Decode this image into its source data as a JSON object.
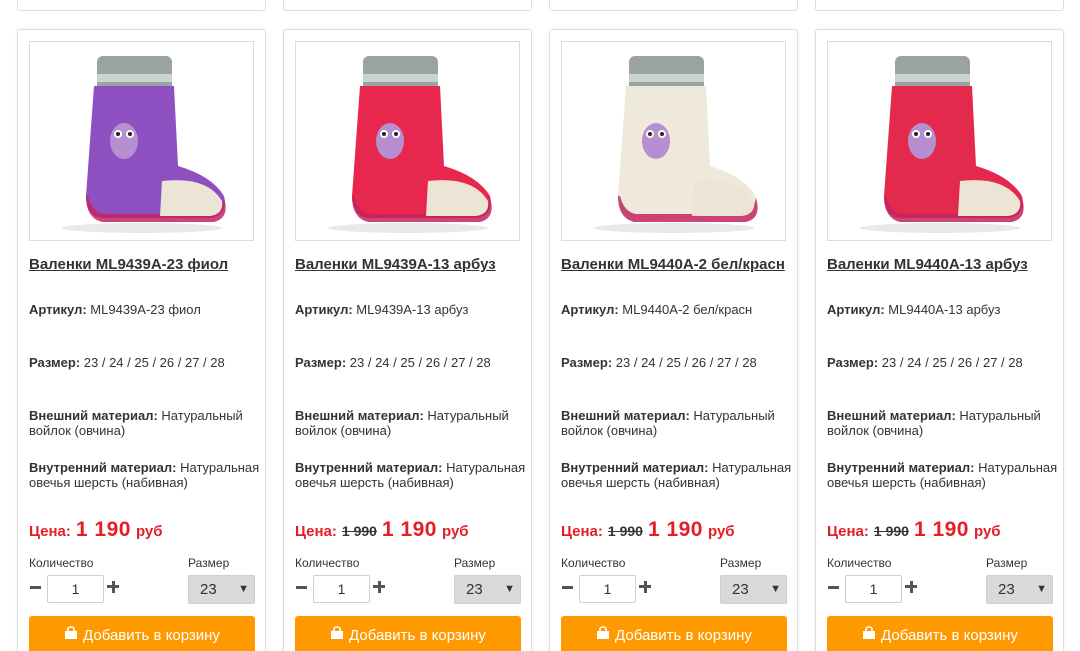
{
  "products": [
    {
      "name": "Валенки ML9439A-23 фиол",
      "article_label": "Артикул:",
      "article": "ML9439A-23 фиол",
      "size_label": "Размер:",
      "sizes": "23 / 24 / 25 / 26 / 27 / 28",
      "outer_label": "Внешний материал:",
      "outer": "Натуральный войлок (овчина)",
      "inner_label": "Внутренний материал:",
      "inner": "Натуральная овечья шерсть (набивная)",
      "price_label": "Цена:",
      "old_price": "",
      "price": "1 190",
      "currency": "руб",
      "qty_label": "Количество",
      "qty": "1",
      "size_select_label": "Размер",
      "size_selected": "23",
      "button": "Добавить в корзину",
      "boot_color": "#8e4fc1"
    },
    {
      "name": "Валенки ML9439A-13 арбуз",
      "article_label": "Артикул:",
      "article": "ML9439A-13 арбуз",
      "size_label": "Размер:",
      "sizes": "23 / 24 / 25 / 26 / 27 / 28",
      "outer_label": "Внешний материал:",
      "outer": "Натуральный войлок (овчина)",
      "inner_label": "Внутренний материал:",
      "inner": "Натуральная овечья шерсть (набивная)",
      "price_label": "Цена:",
      "old_price": "1 990",
      "price": "1 190",
      "currency": "руб",
      "qty_label": "Количество",
      "qty": "1",
      "size_select_label": "Размер",
      "size_selected": "23",
      "button": "Добавить в корзину",
      "boot_color": "#e8274f"
    },
    {
      "name": "Валенки ML9440A-2 бел/красн",
      "article_label": "Артикул:",
      "article": "ML9440A-2 бел/красн",
      "size_label": "Размер:",
      "sizes": "23 / 24 / 25 / 26 / 27 / 28",
      "outer_label": "Внешний материал:",
      "outer": "Натуральный войлок (овчина)",
      "inner_label": "Внутренний материал:",
      "inner": "Натуральная овечья шерсть (набивная)",
      "price_label": "Цена:",
      "old_price": "1 990",
      "price": "1 190",
      "currency": "руб",
      "qty_label": "Количество",
      "qty": "1",
      "size_select_label": "Размер",
      "size_selected": "23",
      "button": "Добавить в корзину",
      "boot_color": "#efe9dc"
    },
    {
      "name": "Валенки ML9440A-13 арбуз",
      "article_label": "Артикул:",
      "article": "ML9440A-13 арбуз",
      "size_label": "Размер:",
      "sizes": "23 / 24 / 25 / 26 / 27 / 28",
      "outer_label": "Внешний материал:",
      "outer": "Натуральный войлок (овчина)",
      "inner_label": "Внутренний материал:",
      "inner": "Натуральная овечья шерсть (набивная)",
      "price_label": "Цена:",
      "old_price": "1 990",
      "price": "1 190",
      "currency": "руб",
      "qty_label": "Количество",
      "qty": "1",
      "size_select_label": "Размер",
      "size_selected": "23",
      "button": "Добавить в корзину",
      "boot_color": "#e32a4c"
    }
  ],
  "colors": {
    "accent_red": "#e31e24",
    "button_orange": "#ff9900"
  },
  "icons": {
    "bag": "shopping-bag-icon",
    "minus": "minus-icon",
    "plus": "plus-icon",
    "dropdown": "dropdown-arrow-icon"
  }
}
